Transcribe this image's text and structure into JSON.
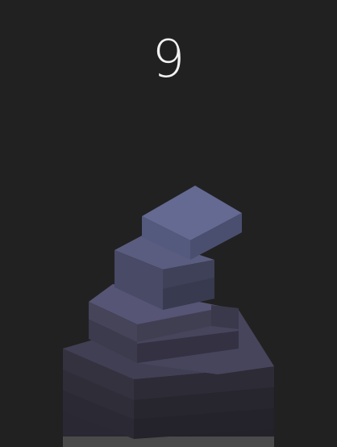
{
  "game": {
    "score": "9"
  },
  "colors": {
    "background": "#212121",
    "score_text": "#f2f2f2",
    "top_block_top": "#646a92",
    "top_block_left": "#545a7e",
    "top_block_right": "#4a4f70",
    "block_top_mid": "#545576",
    "block_left_dark": "#3b3a4e",
    "block_right_dark": "#2f2e3e",
    "base_light": "#4d4d4d"
  }
}
